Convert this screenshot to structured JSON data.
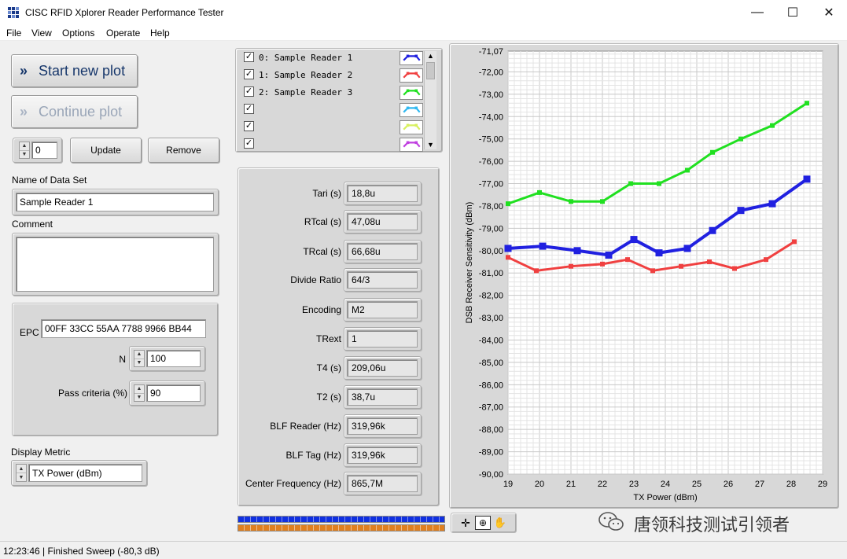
{
  "window": {
    "title": "CISC RFID Xplorer Reader Performance Tester",
    "minimize_glyph": "—",
    "maximize_glyph": "☐",
    "close_glyph": "✕"
  },
  "menu": [
    "File",
    "View",
    "Options",
    "Operate",
    "Help"
  ],
  "left": {
    "start_label": "Start new plot",
    "continue_label": "Continue plot",
    "index_value": "0",
    "update_label": "Update",
    "remove_label": "Remove",
    "name_label": "Name of Data Set",
    "name_value": "Sample Reader 1",
    "comment_label": "Comment",
    "comment_value": "",
    "epc_label": "EPC",
    "epc_value": "00FF 33CC 55AA 7788 9966 BB44",
    "n_label": "N",
    "n_value": "100",
    "pass_label": "Pass criteria (%)",
    "pass_value": "90",
    "metric_label": "Display Metric",
    "metric_value": "TX Power (dBm)"
  },
  "legend": [
    {
      "checked": true,
      "label": "0: Sample Reader 1",
      "color": "#2020e0"
    },
    {
      "checked": true,
      "label": "1: Sample Reader 2",
      "color": "#f04040"
    },
    {
      "checked": true,
      "label": "2: Sample Reader 3",
      "color": "#20e020"
    },
    {
      "checked": true,
      "label": "",
      "color": "#30b8f0"
    },
    {
      "checked": true,
      "label": "",
      "color": "#d8f060"
    },
    {
      "checked": true,
      "label": "",
      "color": "#c040e0"
    }
  ],
  "params": [
    {
      "label": "Tari (s)",
      "value": "18,8u"
    },
    {
      "label": "RTcal (s)",
      "value": "47,08u"
    },
    {
      "label": "TRcal (s)",
      "value": "66,68u"
    },
    {
      "label": "Divide Ratio",
      "value": "64/3"
    },
    {
      "label": "Encoding",
      "value": "M2"
    },
    {
      "label": "TRext",
      "value": "1"
    },
    {
      "label": "T4 (s)",
      "value": "209,06u"
    },
    {
      "label": "T2 (s)",
      "value": "38,7u"
    },
    {
      "label": "BLF Reader (Hz)",
      "value": "319,96k"
    },
    {
      "label": "BLF Tag (Hz)",
      "value": "319,96k"
    },
    {
      "label": "Center Frequency (Hz)",
      "value": "865,7M"
    }
  ],
  "progress": {
    "top_fraction": 1.0,
    "bottom_fraction": 1.0,
    "top_color": "#1030e0",
    "bottom_color": "#e08020"
  },
  "status": "12:23:46 | Finished Sweep (-80,3 dB)",
  "watermark": "唐领科技测试引领者",
  "chart_data": {
    "type": "line",
    "xlabel": "TX Power (dBm)",
    "ylabel": "DSB Receiver Sensitivity (dBm)",
    "xlim": [
      19,
      29
    ],
    "ylim": [
      -90,
      -71.07
    ],
    "xticks": [
      19,
      20,
      21,
      22,
      23,
      24,
      25,
      26,
      27,
      28,
      29
    ],
    "yticks": [
      "-71,07",
      "-72,00",
      "-73,00",
      "-74,00",
      "-75,00",
      "-76,00",
      "-77,00",
      "-78,00",
      "-79,00",
      "-80,00",
      "-81,00",
      "-82,00",
      "-83,00",
      "-84,00",
      "-85,00",
      "-86,00",
      "-87,00",
      "-88,00",
      "-89,00",
      "-90,00"
    ],
    "ytick_values": [
      -71.07,
      -72,
      -73,
      -74,
      -75,
      -76,
      -77,
      -78,
      -79,
      -80,
      -81,
      -82,
      -83,
      -84,
      -85,
      -86,
      -87,
      -88,
      -89,
      -90
    ],
    "grid": true,
    "series": [
      {
        "color": "#2020e0",
        "x": [
          19.0,
          20.1,
          21.2,
          22.2,
          23.0,
          23.8,
          24.7,
          25.5,
          26.4,
          27.4,
          28.5
        ],
        "y": [
          -79.9,
          -79.8,
          -80.0,
          -80.2,
          -79.5,
          -80.1,
          -79.9,
          -79.1,
          -78.2,
          -77.9,
          -76.8
        ]
      },
      {
        "color": "#f04040",
        "x": [
          19.0,
          19.9,
          21.0,
          22.0,
          22.8,
          23.6,
          24.5,
          25.4,
          26.2,
          27.2,
          28.1
        ],
        "y": [
          -80.3,
          -80.9,
          -80.7,
          -80.6,
          -80.4,
          -80.9,
          -80.7,
          -80.5,
          -80.8,
          -80.4,
          -79.6
        ]
      },
      {
        "color": "#20e020",
        "x": [
          19.0,
          20.0,
          21.0,
          22.0,
          22.9,
          23.8,
          24.7,
          25.5,
          26.4,
          27.4,
          28.5
        ],
        "y": [
          -77.9,
          -77.4,
          -77.8,
          -77.8,
          -77.0,
          -77.0,
          -76.4,
          -75.6,
          -75.0,
          -74.4,
          -73.4
        ]
      }
    ]
  }
}
